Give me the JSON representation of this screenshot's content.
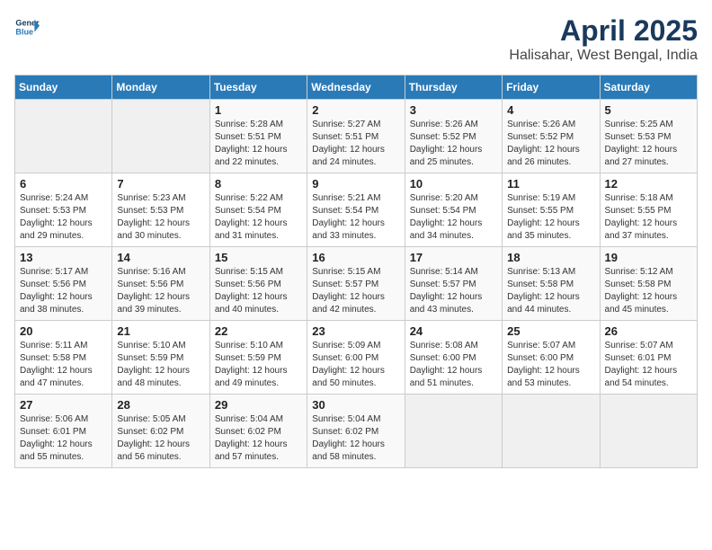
{
  "header": {
    "logo_line1": "General",
    "logo_line2": "Blue",
    "title": "April 2025",
    "subtitle": "Halisahar, West Bengal, India"
  },
  "calendar": {
    "days_of_week": [
      "Sunday",
      "Monday",
      "Tuesday",
      "Wednesday",
      "Thursday",
      "Friday",
      "Saturday"
    ],
    "weeks": [
      [
        {
          "day": "",
          "sunrise": "",
          "sunset": "",
          "daylight": ""
        },
        {
          "day": "",
          "sunrise": "",
          "sunset": "",
          "daylight": ""
        },
        {
          "day": "1",
          "sunrise": "Sunrise: 5:28 AM",
          "sunset": "Sunset: 5:51 PM",
          "daylight": "Daylight: 12 hours and 22 minutes."
        },
        {
          "day": "2",
          "sunrise": "Sunrise: 5:27 AM",
          "sunset": "Sunset: 5:51 PM",
          "daylight": "Daylight: 12 hours and 24 minutes."
        },
        {
          "day": "3",
          "sunrise": "Sunrise: 5:26 AM",
          "sunset": "Sunset: 5:52 PM",
          "daylight": "Daylight: 12 hours and 25 minutes."
        },
        {
          "day": "4",
          "sunrise": "Sunrise: 5:26 AM",
          "sunset": "Sunset: 5:52 PM",
          "daylight": "Daylight: 12 hours and 26 minutes."
        },
        {
          "day": "5",
          "sunrise": "Sunrise: 5:25 AM",
          "sunset": "Sunset: 5:53 PM",
          "daylight": "Daylight: 12 hours and 27 minutes."
        }
      ],
      [
        {
          "day": "6",
          "sunrise": "Sunrise: 5:24 AM",
          "sunset": "Sunset: 5:53 PM",
          "daylight": "Daylight: 12 hours and 29 minutes."
        },
        {
          "day": "7",
          "sunrise": "Sunrise: 5:23 AM",
          "sunset": "Sunset: 5:53 PM",
          "daylight": "Daylight: 12 hours and 30 minutes."
        },
        {
          "day": "8",
          "sunrise": "Sunrise: 5:22 AM",
          "sunset": "Sunset: 5:54 PM",
          "daylight": "Daylight: 12 hours and 31 minutes."
        },
        {
          "day": "9",
          "sunrise": "Sunrise: 5:21 AM",
          "sunset": "Sunset: 5:54 PM",
          "daylight": "Daylight: 12 hours and 33 minutes."
        },
        {
          "day": "10",
          "sunrise": "Sunrise: 5:20 AM",
          "sunset": "Sunset: 5:54 PM",
          "daylight": "Daylight: 12 hours and 34 minutes."
        },
        {
          "day": "11",
          "sunrise": "Sunrise: 5:19 AM",
          "sunset": "Sunset: 5:55 PM",
          "daylight": "Daylight: 12 hours and 35 minutes."
        },
        {
          "day": "12",
          "sunrise": "Sunrise: 5:18 AM",
          "sunset": "Sunset: 5:55 PM",
          "daylight": "Daylight: 12 hours and 37 minutes."
        }
      ],
      [
        {
          "day": "13",
          "sunrise": "Sunrise: 5:17 AM",
          "sunset": "Sunset: 5:56 PM",
          "daylight": "Daylight: 12 hours and 38 minutes."
        },
        {
          "day": "14",
          "sunrise": "Sunrise: 5:16 AM",
          "sunset": "Sunset: 5:56 PM",
          "daylight": "Daylight: 12 hours and 39 minutes."
        },
        {
          "day": "15",
          "sunrise": "Sunrise: 5:15 AM",
          "sunset": "Sunset: 5:56 PM",
          "daylight": "Daylight: 12 hours and 40 minutes."
        },
        {
          "day": "16",
          "sunrise": "Sunrise: 5:15 AM",
          "sunset": "Sunset: 5:57 PM",
          "daylight": "Daylight: 12 hours and 42 minutes."
        },
        {
          "day": "17",
          "sunrise": "Sunrise: 5:14 AM",
          "sunset": "Sunset: 5:57 PM",
          "daylight": "Daylight: 12 hours and 43 minutes."
        },
        {
          "day": "18",
          "sunrise": "Sunrise: 5:13 AM",
          "sunset": "Sunset: 5:58 PM",
          "daylight": "Daylight: 12 hours and 44 minutes."
        },
        {
          "day": "19",
          "sunrise": "Sunrise: 5:12 AM",
          "sunset": "Sunset: 5:58 PM",
          "daylight": "Daylight: 12 hours and 45 minutes."
        }
      ],
      [
        {
          "day": "20",
          "sunrise": "Sunrise: 5:11 AM",
          "sunset": "Sunset: 5:58 PM",
          "daylight": "Daylight: 12 hours and 47 minutes."
        },
        {
          "day": "21",
          "sunrise": "Sunrise: 5:10 AM",
          "sunset": "Sunset: 5:59 PM",
          "daylight": "Daylight: 12 hours and 48 minutes."
        },
        {
          "day": "22",
          "sunrise": "Sunrise: 5:10 AM",
          "sunset": "Sunset: 5:59 PM",
          "daylight": "Daylight: 12 hours and 49 minutes."
        },
        {
          "day": "23",
          "sunrise": "Sunrise: 5:09 AM",
          "sunset": "Sunset: 6:00 PM",
          "daylight": "Daylight: 12 hours and 50 minutes."
        },
        {
          "day": "24",
          "sunrise": "Sunrise: 5:08 AM",
          "sunset": "Sunset: 6:00 PM",
          "daylight": "Daylight: 12 hours and 51 minutes."
        },
        {
          "day": "25",
          "sunrise": "Sunrise: 5:07 AM",
          "sunset": "Sunset: 6:00 PM",
          "daylight": "Daylight: 12 hours and 53 minutes."
        },
        {
          "day": "26",
          "sunrise": "Sunrise: 5:07 AM",
          "sunset": "Sunset: 6:01 PM",
          "daylight": "Daylight: 12 hours and 54 minutes."
        }
      ],
      [
        {
          "day": "27",
          "sunrise": "Sunrise: 5:06 AM",
          "sunset": "Sunset: 6:01 PM",
          "daylight": "Daylight: 12 hours and 55 minutes."
        },
        {
          "day": "28",
          "sunrise": "Sunrise: 5:05 AM",
          "sunset": "Sunset: 6:02 PM",
          "daylight": "Daylight: 12 hours and 56 minutes."
        },
        {
          "day": "29",
          "sunrise": "Sunrise: 5:04 AM",
          "sunset": "Sunset: 6:02 PM",
          "daylight": "Daylight: 12 hours and 57 minutes."
        },
        {
          "day": "30",
          "sunrise": "Sunrise: 5:04 AM",
          "sunset": "Sunset: 6:02 PM",
          "daylight": "Daylight: 12 hours and 58 minutes."
        },
        {
          "day": "",
          "sunrise": "",
          "sunset": "",
          "daylight": ""
        },
        {
          "day": "",
          "sunrise": "",
          "sunset": "",
          "daylight": ""
        },
        {
          "day": "",
          "sunrise": "",
          "sunset": "",
          "daylight": ""
        }
      ]
    ]
  }
}
